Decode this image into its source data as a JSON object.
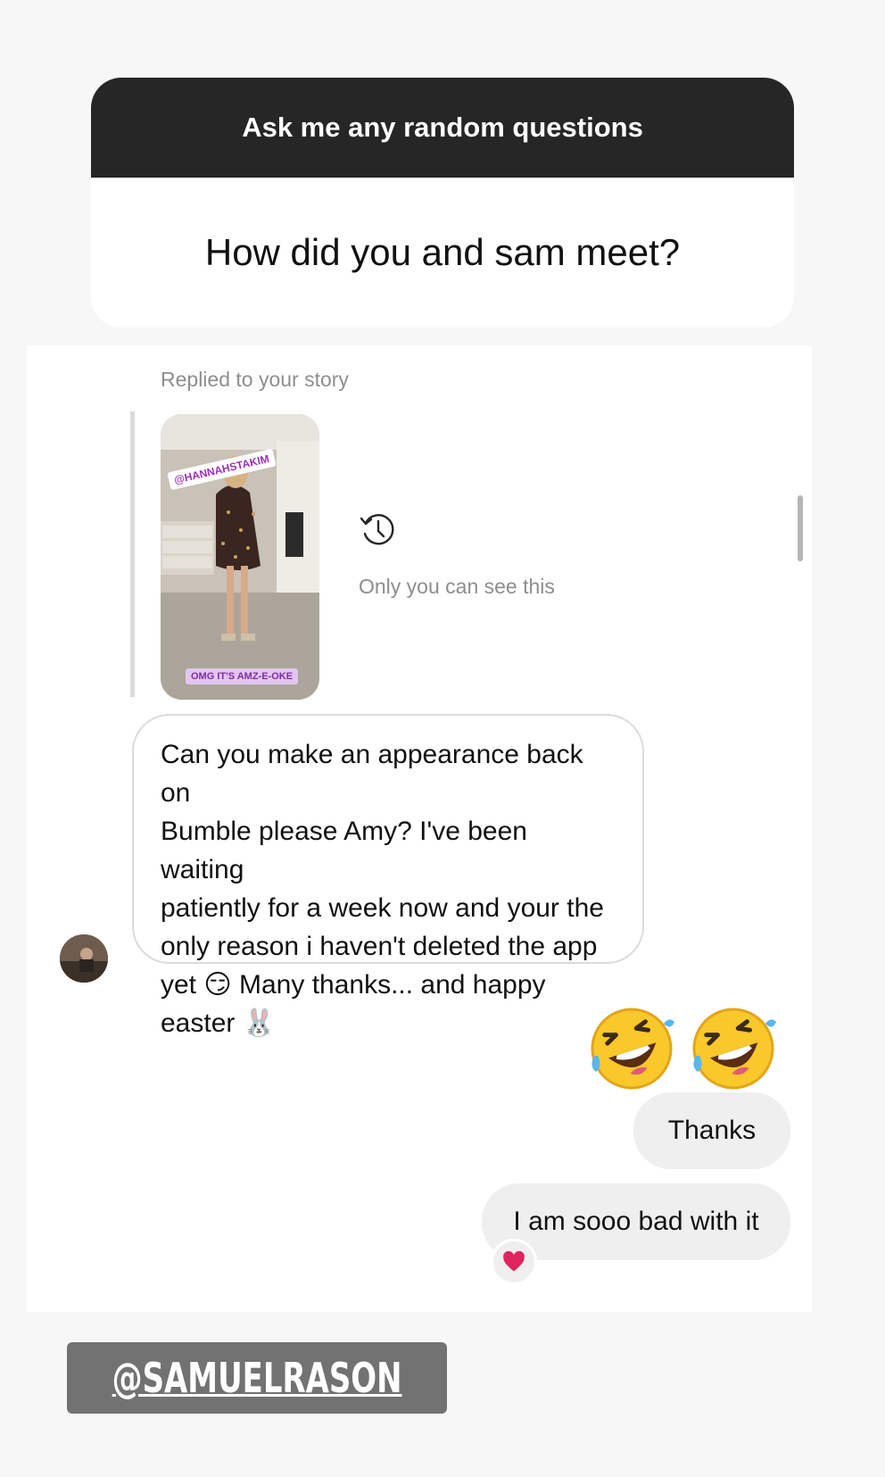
{
  "question_card": {
    "header": "Ask me any random questions",
    "question": "How did you and sam meet?"
  },
  "chat": {
    "replied_label": "Replied to your story",
    "story_thumbnail": {
      "tag_top": "@HANNAHSTAKIM",
      "tag_bottom": "OMG IT'S AMZ-E-OKE"
    },
    "private_note": {
      "icon": "history-clock-icon",
      "text": "Only you can see this"
    },
    "incoming_message": {
      "line1": "Can you make an appearance back on",
      "line2": "Bumble please Amy? I've been waiting",
      "line3": "patiently for a week now and your the",
      "line4": "only reason i haven't deleted the app",
      "line5a": "yet",
      "emoji_smirk": "😏",
      "line5b": "Many thanks... and happy",
      "line6": "easter",
      "emoji_rabbit": "🐰"
    },
    "outgoing_emojis": [
      "rofl-emoji-icon",
      "rofl-emoji-icon"
    ],
    "outgoing_messages": [
      "Thanks",
      "I am sooo bad with it"
    ],
    "reaction": "heart-icon"
  },
  "mention_sticker": "@SAMUELRASON"
}
